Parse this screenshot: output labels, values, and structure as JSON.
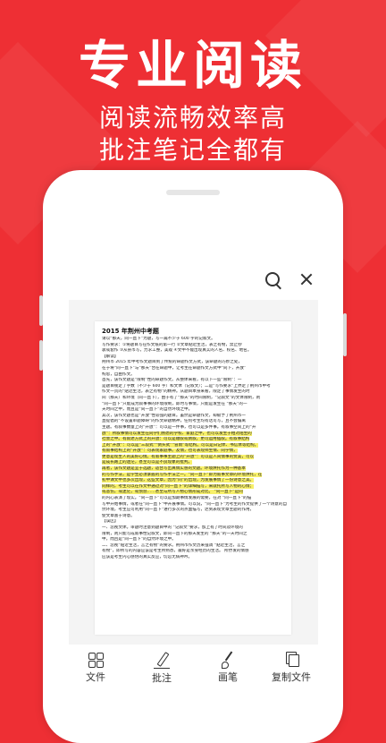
{
  "promo": {
    "headline": "专业阅读",
    "line1": "阅读流畅效率高",
    "line2": "批注笔记全都有"
  },
  "colors": {
    "brand_red": "#ee2f34",
    "highlight": "#f7f06a"
  },
  "topbar": {
    "icons": [
      "search-icon",
      "close-icon"
    ]
  },
  "document": {
    "title": "2015 年荆州中考题",
    "lines": [
      {
        "text": "请以“那天，同一直下”为题，写一篇不少于 600 字的记叙文。",
        "hl": false
      },
      {
        "text": "写作要求：①将题目写在作文纸的第一行 ②文章贴近生活，表之有物，禁止抄",
        "hl": false
      },
      {
        "text": "袭或套作 ③从县市写，力求工整，美观 ④文中不能出现真实的人名、校名、地名。",
        "hl": false
      },
      {
        "text": "【解读】",
        "hl": false
      },
      {
        "text": "荆州市 2015 年中考作文题目到了传统的命题作文方式，该命题的巧妙之处，",
        "hl": false
      },
      {
        "text": "在于将“同一直下”与“那天”合在命题中，让考生在命题作文方式中“同下，开放”",
        "hl": false
      },
      {
        "text": "构思，自由作文。",
        "hl": false
      },
      {
        "text": "首先，该作文题是“限制”性的命题作文。从整体来看，有以下一些“限制”：一",
        "hl": false
      },
      {
        "text": "是题目规定了字数（不少于 600 字）和文体（记叙文）；二是“写作要求”上界定了荆州市中考",
        "hl": false
      },
      {
        "text": "作文一贯的“贴近生活，表之有物”的精神。从题目本身来看，限定了事情发生的时",
        "hl": false
      },
      {
        "text": "间（那天）和环境（同一直下），由于有了“那天”的时间限制，“记叙文”的文体限制，则",
        "hl": false
      },
      {
        "text": "“同一直下”只能成为叙事事的环境限制，即时写事情，只能是发生在 “那天”的一",
        "hl": false
      },
      {
        "text": "天时间之中，而且是“同一直下”的自然环境之中。",
        "hl": false
      },
      {
        "text": "其次，该作文题也是“开放”性较强的题目。虽然是命题作文，却赋予了荆州市一",
        "hl": false
      },
      {
        "text": "直提倡的“不设置审题障碍”的作文命题精神，任何考生均有话可写，且不会偏离",
        "hl": false
      },
      {
        "text": "主题。有叙事数量上的“开放”：可以是一件事，也可以是多件事。有叙事空间上的“开",
        "hl": false
      },
      {
        "text": "放”：所叙事情可以发生在同学们熟悉的学校、家庭之中，也可以发生于相对陌生的",
        "hl": true
      },
      {
        "text": "社会之中。有叙述方式上的开放：可以是顺叙或倒叙，更可运用插叙。有叙事结构",
        "hl": true
      },
      {
        "text": "上的“开放”：可以是“三段式”“倒头式”“冒雨”等结构。可以是日记体、书信体等结构。",
        "hl": true
      },
      {
        "text": "有叙事结构上的“开放”：可表现家庭事。友情，也可表现师生情、同学情，",
        "hl": true
      },
      {
        "text": "更意是现生人的美好心情。有叙事事主题上的“开放”：可以是人间情事的赞美，可以",
        "hl": true
      },
      {
        "text": "是成长路上的迷茫，甚至可以是不良现象的批判。",
        "hl": true
      },
      {
        "text": "再者，该作文题是宜于选题，适合写出真情实感的文题。环境烘托作为一种基本",
        "hl": true
      },
      {
        "text": "的写作手法，是学生必须掌握的写作手法之一。“同一直下”即为叙事文章的环境烘托，在",
        "hl": true
      },
      {
        "text": "初中课文中也多次出现，这些文章，因为“同”的出现，为发展事情了一份诗意之美。",
        "hl": true
      },
      {
        "text": "同样的，考生可以在作文中通过对“同一直下”的详细描写，来就托所写人物的心情；",
        "hl": true
      },
      {
        "text": "或悲伤，或迷茫，或愤怒……甚至与所写人物心情形成对比。 “同一直下”是同",
        "hl": true
      },
      {
        "text": "的内心表演了现实。“同一直下”可以是加期事情发展的需要，在对 “同一直下”的描",
        "hl": false
      },
      {
        "text": "写中开始事情，或者在“同一直下”中开展事情。可以说，“同一直下”为考生的作文提供了一个诗意的自",
        "hl": false
      },
      {
        "text": "然环境，考生应可利用“同一直下”进行多次的点面描写，达到表现文章主题的作用，",
        "hl": false
      },
      {
        "text": "使文章富于诗意。",
        "hl": false
      },
      {
        "text": "【误区】",
        "hl": false
      },
      {
        "text": "一、忽视文体。审题时注意到题目中的 “记叙文”要求，加上有了时间及环境的",
        "hl": false
      },
      {
        "text": "限制，则只能写成叙事性记叙文，即同一直下的那天发生的 “那天”的一天时间之",
        "hl": false
      },
      {
        "text": "中，而且是“同一直下”的自然环境之中。",
        "hl": false
      },
      {
        "text": "二、忽视“贴近生活，言之有物”的要求。荆州市作文历来强调 “贴近生活，言之",
        "hl": false
      },
      {
        "text": "有物”，即所写的内容应该是考生所熟悉，最好是亲身经历的生活。 所抒发的情感",
        "hl": false
      },
      {
        "text": "应该是考生内心感悟的真实反应，切忌无病神吟。",
        "hl": false
      }
    ]
  },
  "toolbar": {
    "tabs": [
      {
        "label": "文件",
        "icon": "grid-icon"
      },
      {
        "label": "批注",
        "icon": "pen-icon"
      },
      {
        "label": "画笔",
        "icon": "brush-icon"
      },
      {
        "label": "复制文件",
        "icon": "copy-icon"
      }
    ]
  }
}
